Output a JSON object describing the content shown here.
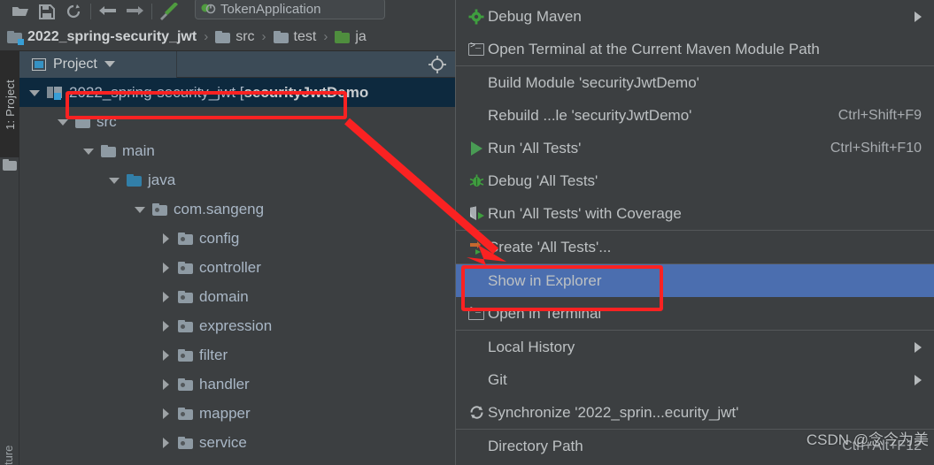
{
  "toolbar": {
    "icons": [
      {
        "name": "open-folder-icon",
        "glyph": "open-folder"
      },
      {
        "name": "save-all-icon",
        "glyph": "save"
      },
      {
        "name": "sync-refresh-icon",
        "glyph": "refresh"
      },
      {
        "name": "undo-icon",
        "glyph": "undo"
      },
      {
        "name": "redo-icon",
        "glyph": "redo"
      },
      {
        "name": "build-hammer-icon",
        "glyph": "hammer"
      }
    ],
    "run_config": {
      "label": "TokenApplication",
      "icon": "run-config-icon"
    }
  },
  "breadcrumb": {
    "items": [
      {
        "label": "2022_spring-security_jwt",
        "icon": "module-folder-icon",
        "bold": true,
        "folder": "module"
      },
      {
        "label": "src",
        "icon": "folder-icon",
        "bold": false,
        "folder": "gray"
      },
      {
        "label": "test",
        "icon": "folder-icon",
        "bold": false,
        "folder": "gray"
      },
      {
        "label": "ja",
        "icon": "test-source-folder-icon",
        "bold": false,
        "folder": "green"
      }
    ],
    "separator": "›"
  },
  "toolstrip": {
    "project_button": "1: Project",
    "bottom_label": "ture"
  },
  "panel": {
    "tab_label": "Project",
    "tab_icon": "project-view-icon",
    "dropdown_icon": "chevron-down-icon",
    "locate_icon": "select-opened-file-icon"
  },
  "tree": {
    "rows": [
      {
        "label": "2022_spring-security_jwt [",
        "bold_label": "securityJwtDemo",
        "indent": 0,
        "state": "open",
        "icon": "module-icon",
        "selected": true
      },
      {
        "label": "src",
        "indent": 1,
        "state": "open",
        "icon": "folder-icon",
        "selected": false
      },
      {
        "label": "main",
        "indent": 2,
        "state": "open",
        "icon": "folder-icon",
        "selected": false
      },
      {
        "label": "java",
        "indent": 3,
        "state": "open",
        "icon": "source-folder-icon",
        "selected": false
      },
      {
        "label": "com.sangeng",
        "indent": 4,
        "state": "open",
        "icon": "package-icon",
        "selected": false
      },
      {
        "label": "config",
        "indent": 5,
        "state": "closed",
        "icon": "package-icon",
        "selected": false
      },
      {
        "label": "controller",
        "indent": 5,
        "state": "closed",
        "icon": "package-icon",
        "selected": false
      },
      {
        "label": "domain",
        "indent": 5,
        "state": "closed",
        "icon": "package-icon",
        "selected": false
      },
      {
        "label": "expression",
        "indent": 5,
        "state": "closed",
        "icon": "package-icon",
        "selected": false
      },
      {
        "label": "filter",
        "indent": 5,
        "state": "closed",
        "icon": "package-icon",
        "selected": false
      },
      {
        "label": "handler",
        "indent": 5,
        "state": "closed",
        "icon": "package-icon",
        "selected": false
      },
      {
        "label": "mapper",
        "indent": 5,
        "state": "closed",
        "icon": "package-icon",
        "selected": false
      },
      {
        "label": "service",
        "indent": 5,
        "state": "closed",
        "icon": "package-icon",
        "selected": false
      }
    ]
  },
  "context_menu": {
    "items": [
      {
        "type": "item",
        "label": "Debug Maven",
        "icon": "maven-gear-icon",
        "accel": "",
        "submenu": true,
        "selected": false
      },
      {
        "type": "item",
        "label": "Open Terminal at the Current Maven Module Path",
        "icon": "terminal-icon",
        "accel": "",
        "submenu": false,
        "selected": false
      },
      {
        "type": "separator"
      },
      {
        "type": "item",
        "label": "Build Module 'securityJwtDemo'",
        "mnemonic": "M",
        "icon": "",
        "accel": "",
        "submenu": false,
        "selected": false
      },
      {
        "type": "item",
        "label": "Rebuild ...le 'securityJwtDemo'",
        "mnemonic": "e",
        "icon": "",
        "accel": "Ctrl+Shift+F9",
        "submenu": false,
        "selected": false
      },
      {
        "type": "item",
        "label": "Run 'All Tests'",
        "mnemonic": "u",
        "icon": "run-icon",
        "accel": "Ctrl+Shift+F10",
        "submenu": false,
        "selected": false
      },
      {
        "type": "item",
        "label": "Debug 'All Tests'",
        "mnemonic": "D",
        "icon": "debug-icon",
        "accel": "",
        "submenu": false,
        "selected": false
      },
      {
        "type": "item",
        "label": "Run 'All Tests' with Coverage",
        "mnemonic": "v",
        "icon": "coverage-icon",
        "accel": "",
        "submenu": false,
        "selected": false
      },
      {
        "type": "separator"
      },
      {
        "type": "item",
        "label": "Create 'All Tests'...",
        "icon": "create-config-icon",
        "accel": "",
        "submenu": false,
        "selected": false
      },
      {
        "type": "separator"
      },
      {
        "type": "item",
        "label": "Show in Explorer",
        "icon": "",
        "accel": "",
        "submenu": false,
        "selected": true
      },
      {
        "type": "item",
        "label": "Open in Terminal",
        "icon": "terminal-icon",
        "accel": "",
        "submenu": false,
        "selected": false
      },
      {
        "type": "separator"
      },
      {
        "type": "item",
        "label": "Local History",
        "mnemonic": "H",
        "icon": "",
        "accel": "",
        "submenu": true,
        "selected": false
      },
      {
        "type": "item",
        "label": "Git",
        "mnemonic": "G",
        "icon": "",
        "accel": "",
        "submenu": true,
        "selected": false
      },
      {
        "type": "item",
        "label": "Synchronize '2022_sprin...ecurity_jwt'",
        "icon": "synchronize-icon",
        "accel": "",
        "submenu": false,
        "selected": false
      },
      {
        "type": "separator"
      },
      {
        "type": "item",
        "label": "Directory Path",
        "icon": "",
        "accel": "Ctrl+Alt+F12",
        "submenu": false,
        "selected": false
      }
    ]
  },
  "watermark": {
    "text": "CSDN @念今为美"
  },
  "colors": {
    "background": "#3c3f41",
    "menu_selected": "#4b6eaf",
    "tree_selected": "#0d293e",
    "annotation_red": "#fa2222",
    "text": "#bdc1c3",
    "accent_blue": "#389fd6",
    "run_green": "#499c54"
  }
}
